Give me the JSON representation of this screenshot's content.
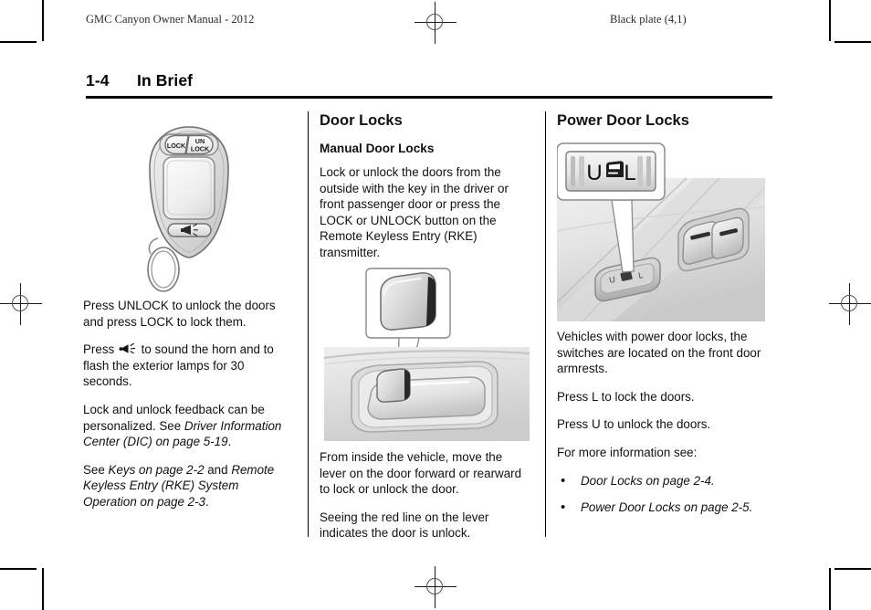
{
  "running_head": {
    "left": "GMC Canyon Owner Manual - 2012",
    "right": "Black plate (4,1)"
  },
  "page_header": {
    "page_number": "1-4",
    "chapter": "In Brief"
  },
  "columns": {
    "left": {
      "figure": {
        "name": "remote-keyless-entry-transmitter",
        "lock_button_label": "LOCK",
        "unlock_button_label_line1": "UN",
        "unlock_button_label_line2": "LOCK"
      },
      "paragraphs": [
        "Press UNLOCK to unlock the doors and press LOCK to lock them.",
        "Press ✦ to sound the horn and to flash the exterior lamps for 30 seconds."
      ],
      "para_horn_before": "Press ",
      "para_horn_after": " to sound the horn and to flash the exterior lamps for 30 seconds.",
      "para_personalize_plain": "Lock and unlock feedback can be personalized. See ",
      "para_personalize_italic": "Driver Information Center (DIC) on page 5‑19",
      "para_personalize_end": ".",
      "para_see_plain1": "See ",
      "para_see_italic1": "Keys on page 2‑2",
      "para_see_plain2": " and ",
      "para_see_italic2": "Remote Keyless Entry (RKE) System Operation on page 2‑3",
      "para_see_end": "."
    },
    "middle": {
      "section_title": "Door Locks",
      "subsection_title": "Manual Door Locks",
      "paragraph_1": "Lock or unlock the doors from the outside with the key in the driver or front passenger door or press the LOCK or UNLOCK button on the Remote Keyless Entry (RKE) transmitter.",
      "figure": {
        "name": "manual-door-lock-lever"
      },
      "paragraph_2": "From inside the vehicle, move the lever on the door forward or rearward to lock or unlock the door.",
      "paragraph_3": "Seeing the red line on the lever indicates the door is unlock."
    },
    "right": {
      "section_title": "Power Door Locks",
      "figure": {
        "name": "power-door-lock-switch",
        "callout_unlock": "U",
        "callout_lock": "L"
      },
      "paragraph_1": "Vehicles with power door locks, the switches are located on the front door armrests.",
      "paragraph_2": "Press L to lock the doors.",
      "paragraph_3": "Press U to unlock the doors.",
      "paragraph_4": "For more information see:",
      "bullets": [
        "Door Locks on page 2‑4.",
        "Power Door Locks on page 2‑5."
      ],
      "bullet_glyph": "•"
    }
  }
}
